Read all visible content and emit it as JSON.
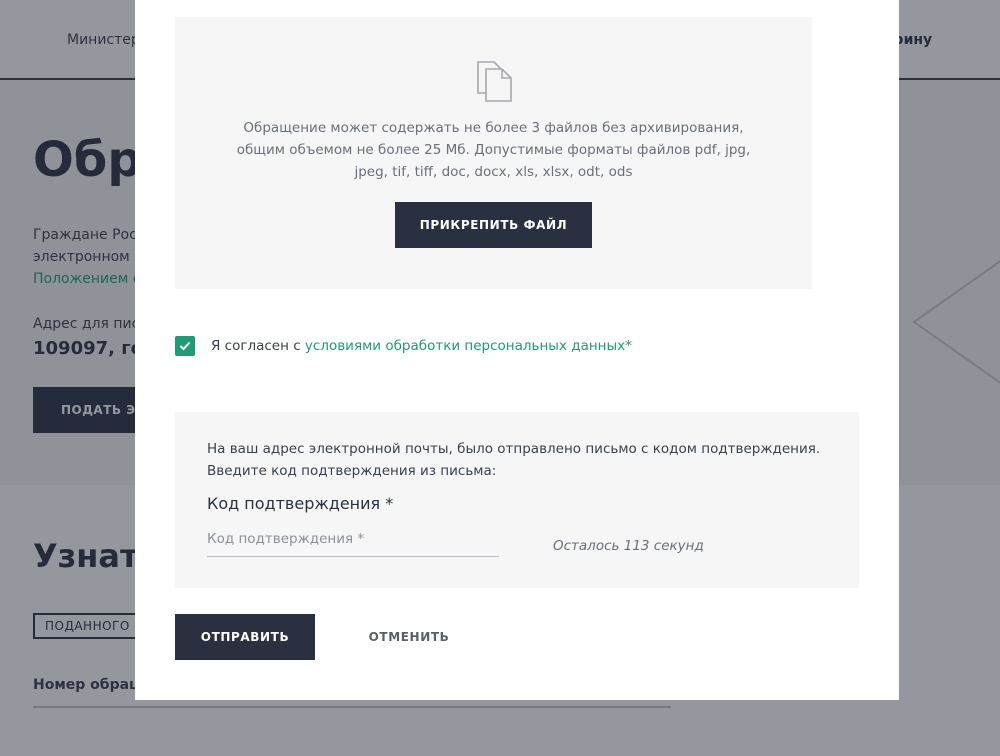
{
  "background": {
    "nav_left": "Министер",
    "nav_right": "нфину",
    "page_title": "Обра",
    "intro_line1": "Граждане Росс",
    "intro_line2": "электронном и",
    "intro_link": "Положением о",
    "address_label": "Адрес для пис",
    "address_value": "109097, го",
    "submit_appeal_button": "ПОДАТЬ ЭЛ",
    "section_title": "Узнать",
    "tag_label": "ПОДАННОГО",
    "field_label": "Номер обраще"
  },
  "modal": {
    "upload": {
      "hint_line1": "Обращение может содержать не более 3 файлов без архивирования,",
      "hint_line2": "общим объемом не более 25 Мб. Допустимые форматы файлов pdf, jpg,",
      "hint_line3": "jpeg, tif, tiff, doc, docx, xls, xlsx, odt, ods",
      "attach_button": "ПРИКРЕПИТЬ ФАЙЛ",
      "icon": "file-copy-icon"
    },
    "consent": {
      "checked": true,
      "text_prefix": "Я согласен с ",
      "link_text": "условиями обработки персональных данных*"
    },
    "confirmation": {
      "info_line1": "На ваш адрес электронной почты, было отправлено письмо с кодом подтверждения.",
      "info_line2": "Введите код подтверждения из письма:",
      "code_label": "Код подтверждения *",
      "code_placeholder": "Код подтверждения *",
      "code_value": "",
      "timer_text": "Осталось 113 секунд"
    },
    "actions": {
      "submit_label": "ОТПРАВИТЬ",
      "cancel_label": "ОТМЕНИТЬ"
    }
  },
  "colors": {
    "accent": "#1f9b77",
    "dark": "#2a3040",
    "panel": "#f6f6f6"
  }
}
